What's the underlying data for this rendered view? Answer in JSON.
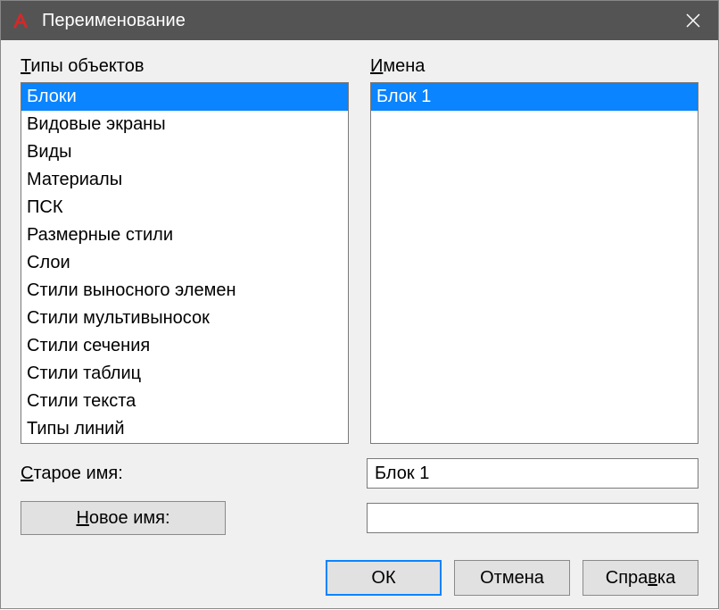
{
  "titlebar": {
    "title": "Переименование"
  },
  "labels": {
    "object_types_prefix": "Т",
    "object_types_rest": "ипы объектов",
    "names_prefix": "И",
    "names_rest": "мена",
    "old_name_prefix": "С",
    "old_name_rest": "тарое имя:",
    "new_name_prefix": "Н",
    "new_name_rest": "овое имя:"
  },
  "object_types": {
    "items": [
      "Блоки",
      "Видовые экраны",
      "Виды",
      "Материалы",
      "ПСК",
      "Размерные стили",
      "Слои",
      "Стили выносного элемен",
      "Стили мультивыносок",
      "Стили сечения",
      "Стили таблиц",
      "Стили текста",
      "Типы линий"
    ],
    "selected_index": 0
  },
  "names": {
    "items": [
      "Блок 1"
    ],
    "selected_index": 0
  },
  "fields": {
    "old_name_value": "Блок 1",
    "new_name_value": ""
  },
  "buttons": {
    "ok": "ОК",
    "cancel": "Отмена",
    "help_prefix": "Спра",
    "help_ul": "в",
    "help_rest": "ка"
  }
}
